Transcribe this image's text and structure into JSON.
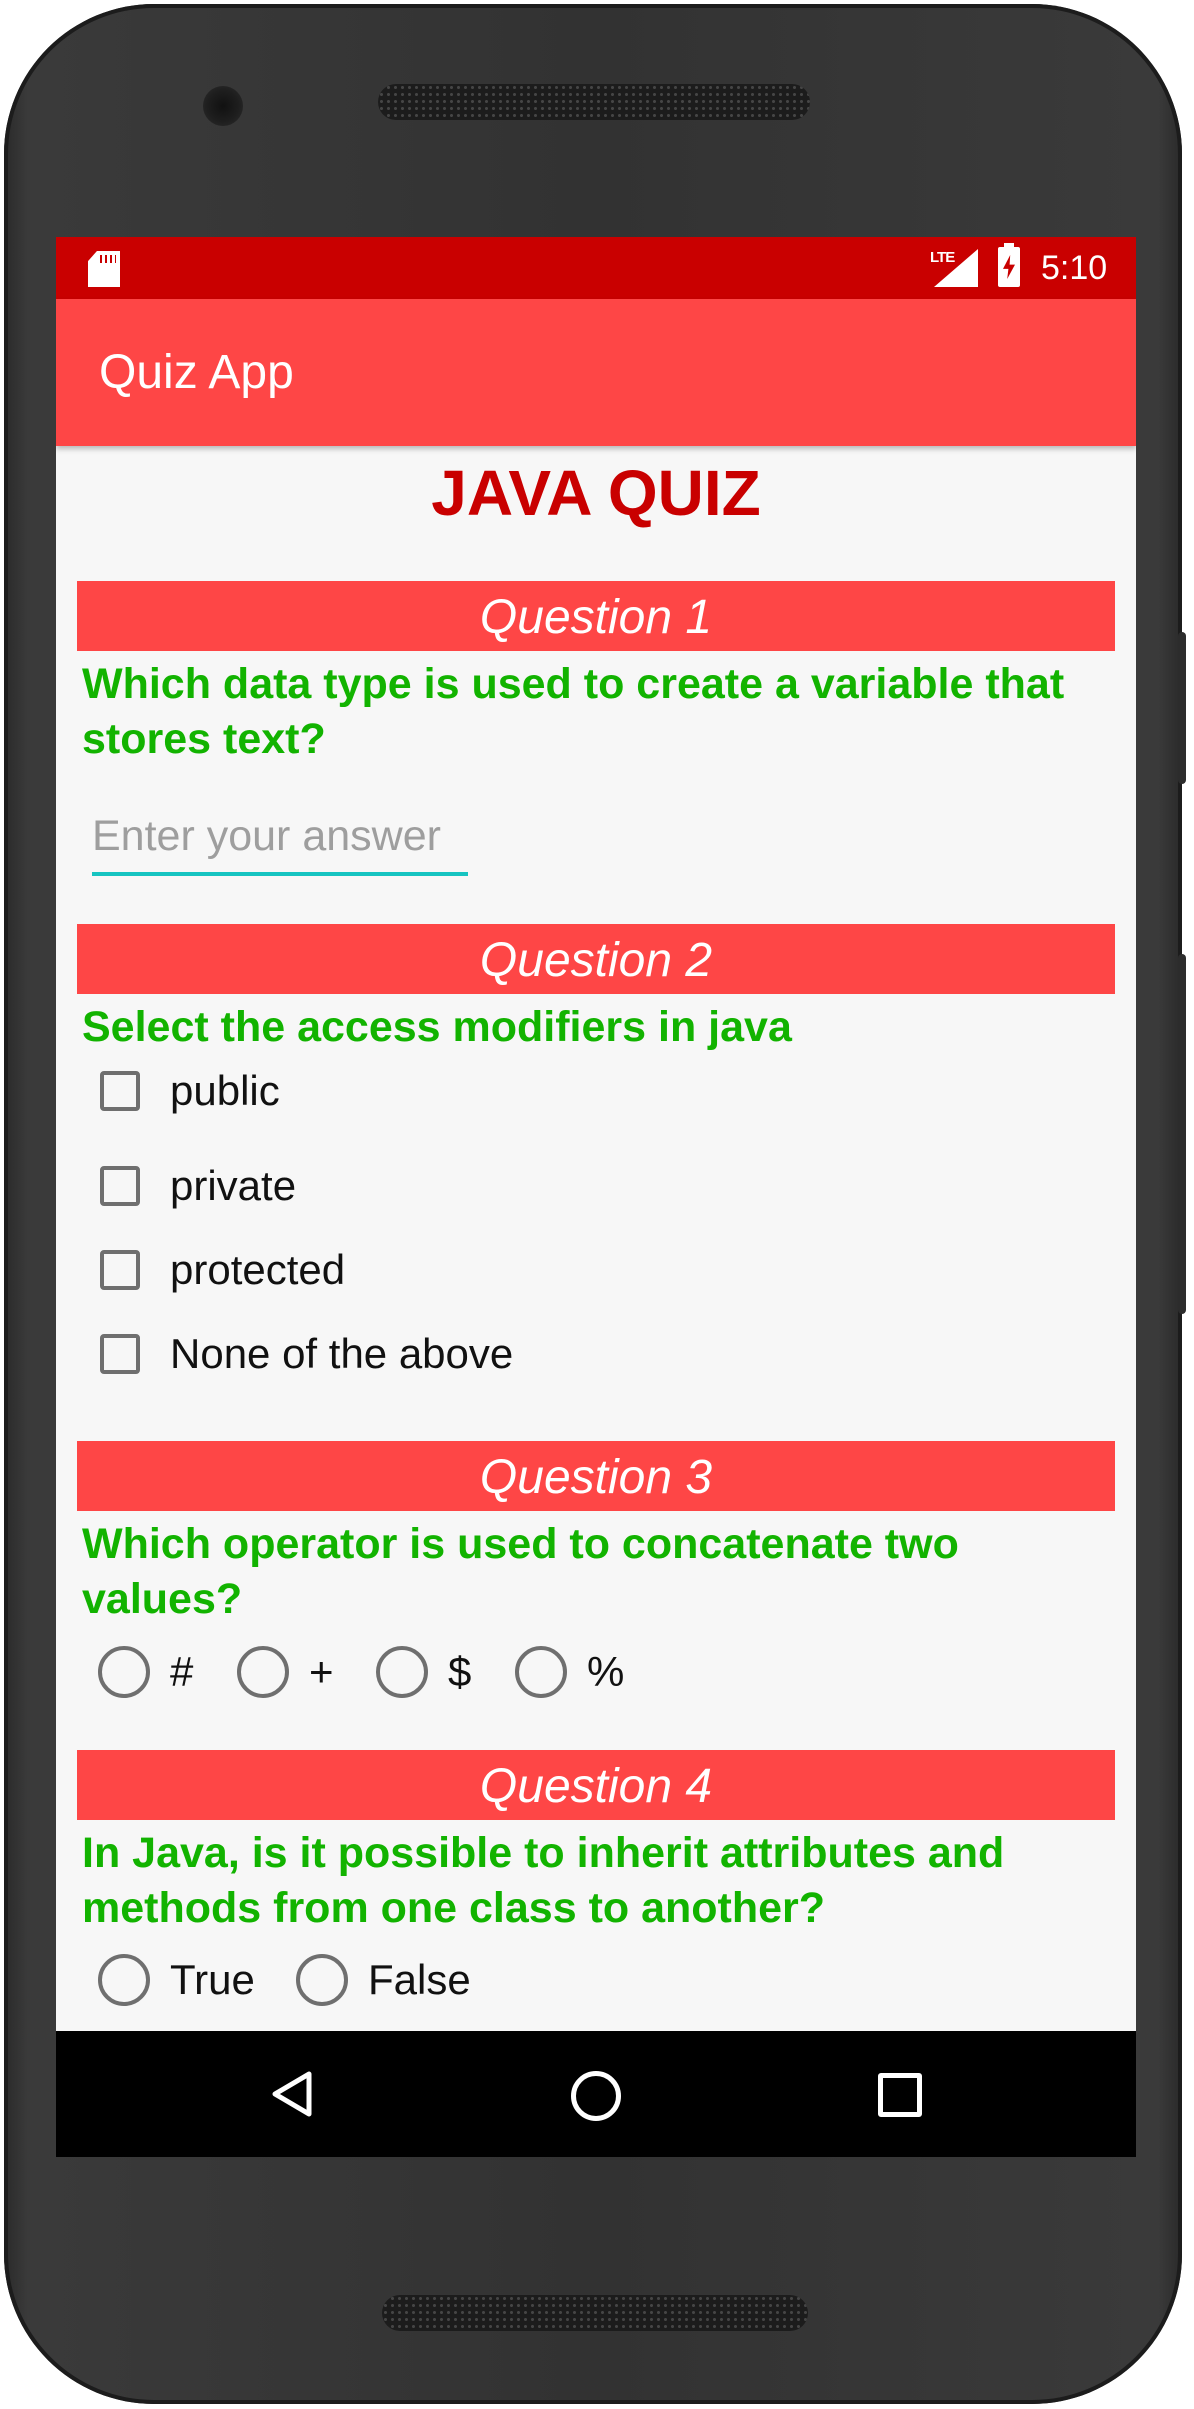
{
  "status_bar": {
    "network": "LTE",
    "time": "5:10"
  },
  "app_bar": {
    "title": "Quiz App"
  },
  "quiz": {
    "title": "JAVA QUIZ",
    "questions": [
      {
        "header": "Question 1",
        "text": "Which data type is used to create a variable that stores text?",
        "answer_placeholder": "Enter your answer",
        "answer_value": ""
      },
      {
        "header": "Question 2",
        "text": "Select the access modifiers in java",
        "options": [
          "public",
          "private",
          "protected",
          "None of the above"
        ]
      },
      {
        "header": "Question 3",
        "text": "Which operator is used to concatenate two values?",
        "options": [
          "#",
          "+",
          "$",
          "%"
        ]
      },
      {
        "header": "Question 4",
        "text": "In Java, is it possible to inherit attributes and methods from one class to another?",
        "options": [
          "True",
          "False"
        ]
      }
    ]
  },
  "colors": {
    "status_bar": "#c90000",
    "app_bar": "#fe4646",
    "title": "#c90000",
    "question_text": "#12b300",
    "input_underline": "#16c4c1"
  },
  "icons": [
    "sd-card-icon",
    "lte-signal-icon",
    "battery-charging-icon",
    "back-icon",
    "home-icon",
    "recents-icon"
  ]
}
